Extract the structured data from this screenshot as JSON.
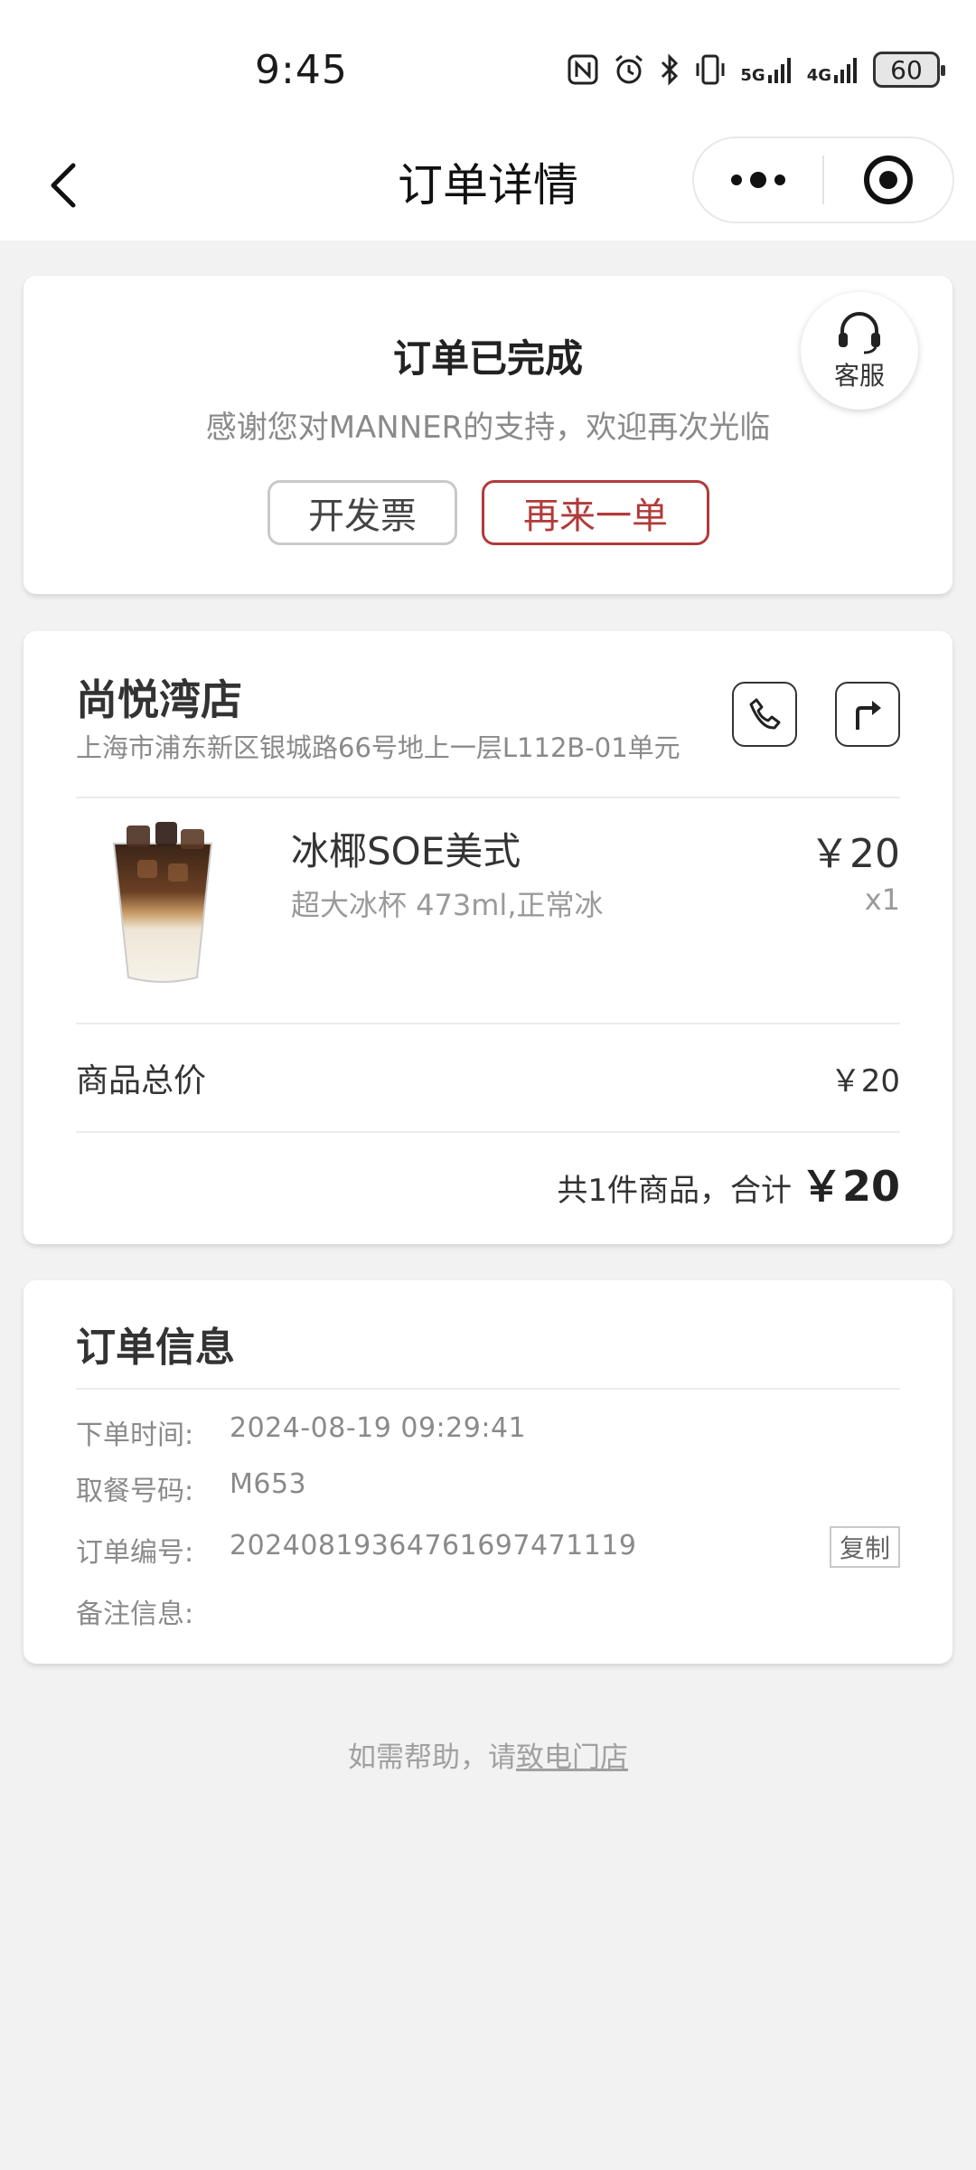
{
  "status_bar": {
    "time": "9:45",
    "network_5g": "5G",
    "network_4g": "4G",
    "battery": "60"
  },
  "nav": {
    "title": "订单详情"
  },
  "order_status": {
    "title": "订单已完成",
    "subtitle": "感谢您对MANNER的支持，欢迎再次光临",
    "invoice_button": "开发票",
    "reorder_button": "再来一单",
    "service_label": "客服"
  },
  "store": {
    "name": "尚悦湾店",
    "address": "上海市浦东新区银城路66号地上一层L112B-01单元"
  },
  "product": {
    "name": "冰椰SOE美式",
    "spec": "超大冰杯 473ml,正常冰",
    "price": "￥20",
    "quantity": "x1"
  },
  "totals": {
    "subtotal_label": "商品总价",
    "subtotal_value": "￥20",
    "summary_text": "共1件商品，合计",
    "summary_total": "￥20"
  },
  "order_info": {
    "title": "订单信息",
    "fields": [
      {
        "label": "下单时间:",
        "value": "2024-08-19 09:29:41"
      },
      {
        "label": "取餐号码:",
        "value": "M653"
      },
      {
        "label": "订单编号:",
        "value": "20240819364761697471119"
      },
      {
        "label": "备注信息:",
        "value": ""
      }
    ],
    "copy_button": "复制"
  },
  "help": {
    "prefix": "如需帮助，请",
    "link": "致电门店"
  },
  "colors": {
    "accent": "#b23a3a",
    "background": "#f2f2f2"
  }
}
